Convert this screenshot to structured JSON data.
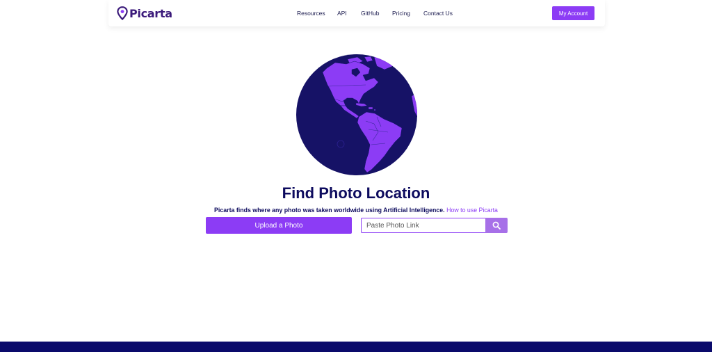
{
  "brand": {
    "name": "Picarta",
    "logo_icon": "location-pin-logo-icon"
  },
  "nav": {
    "items": [
      {
        "label": "Resources"
      },
      {
        "label": "API"
      },
      {
        "label": "GitHub"
      },
      {
        "label": "Pricing"
      },
      {
        "label": "Contact Us"
      }
    ],
    "account_button": "My Account"
  },
  "hero": {
    "globe_icon": "globe-americas-icon",
    "title": "Find Photo Location",
    "subtitle": "Picarta finds where any photo was taken worldwide using Artificial Intelligence.",
    "help_link": "How to use Picarta"
  },
  "actions": {
    "upload_button": "Upload a Photo",
    "link_placeholder": "Paste Photo Link",
    "search_icon": "search-icon"
  },
  "colors": {
    "accent": "#8c3cf5",
    "accent_light": "#a770e8",
    "navy": "#0d0b5e",
    "ocean": "#161266",
    "footer": "#0a0a6b"
  }
}
